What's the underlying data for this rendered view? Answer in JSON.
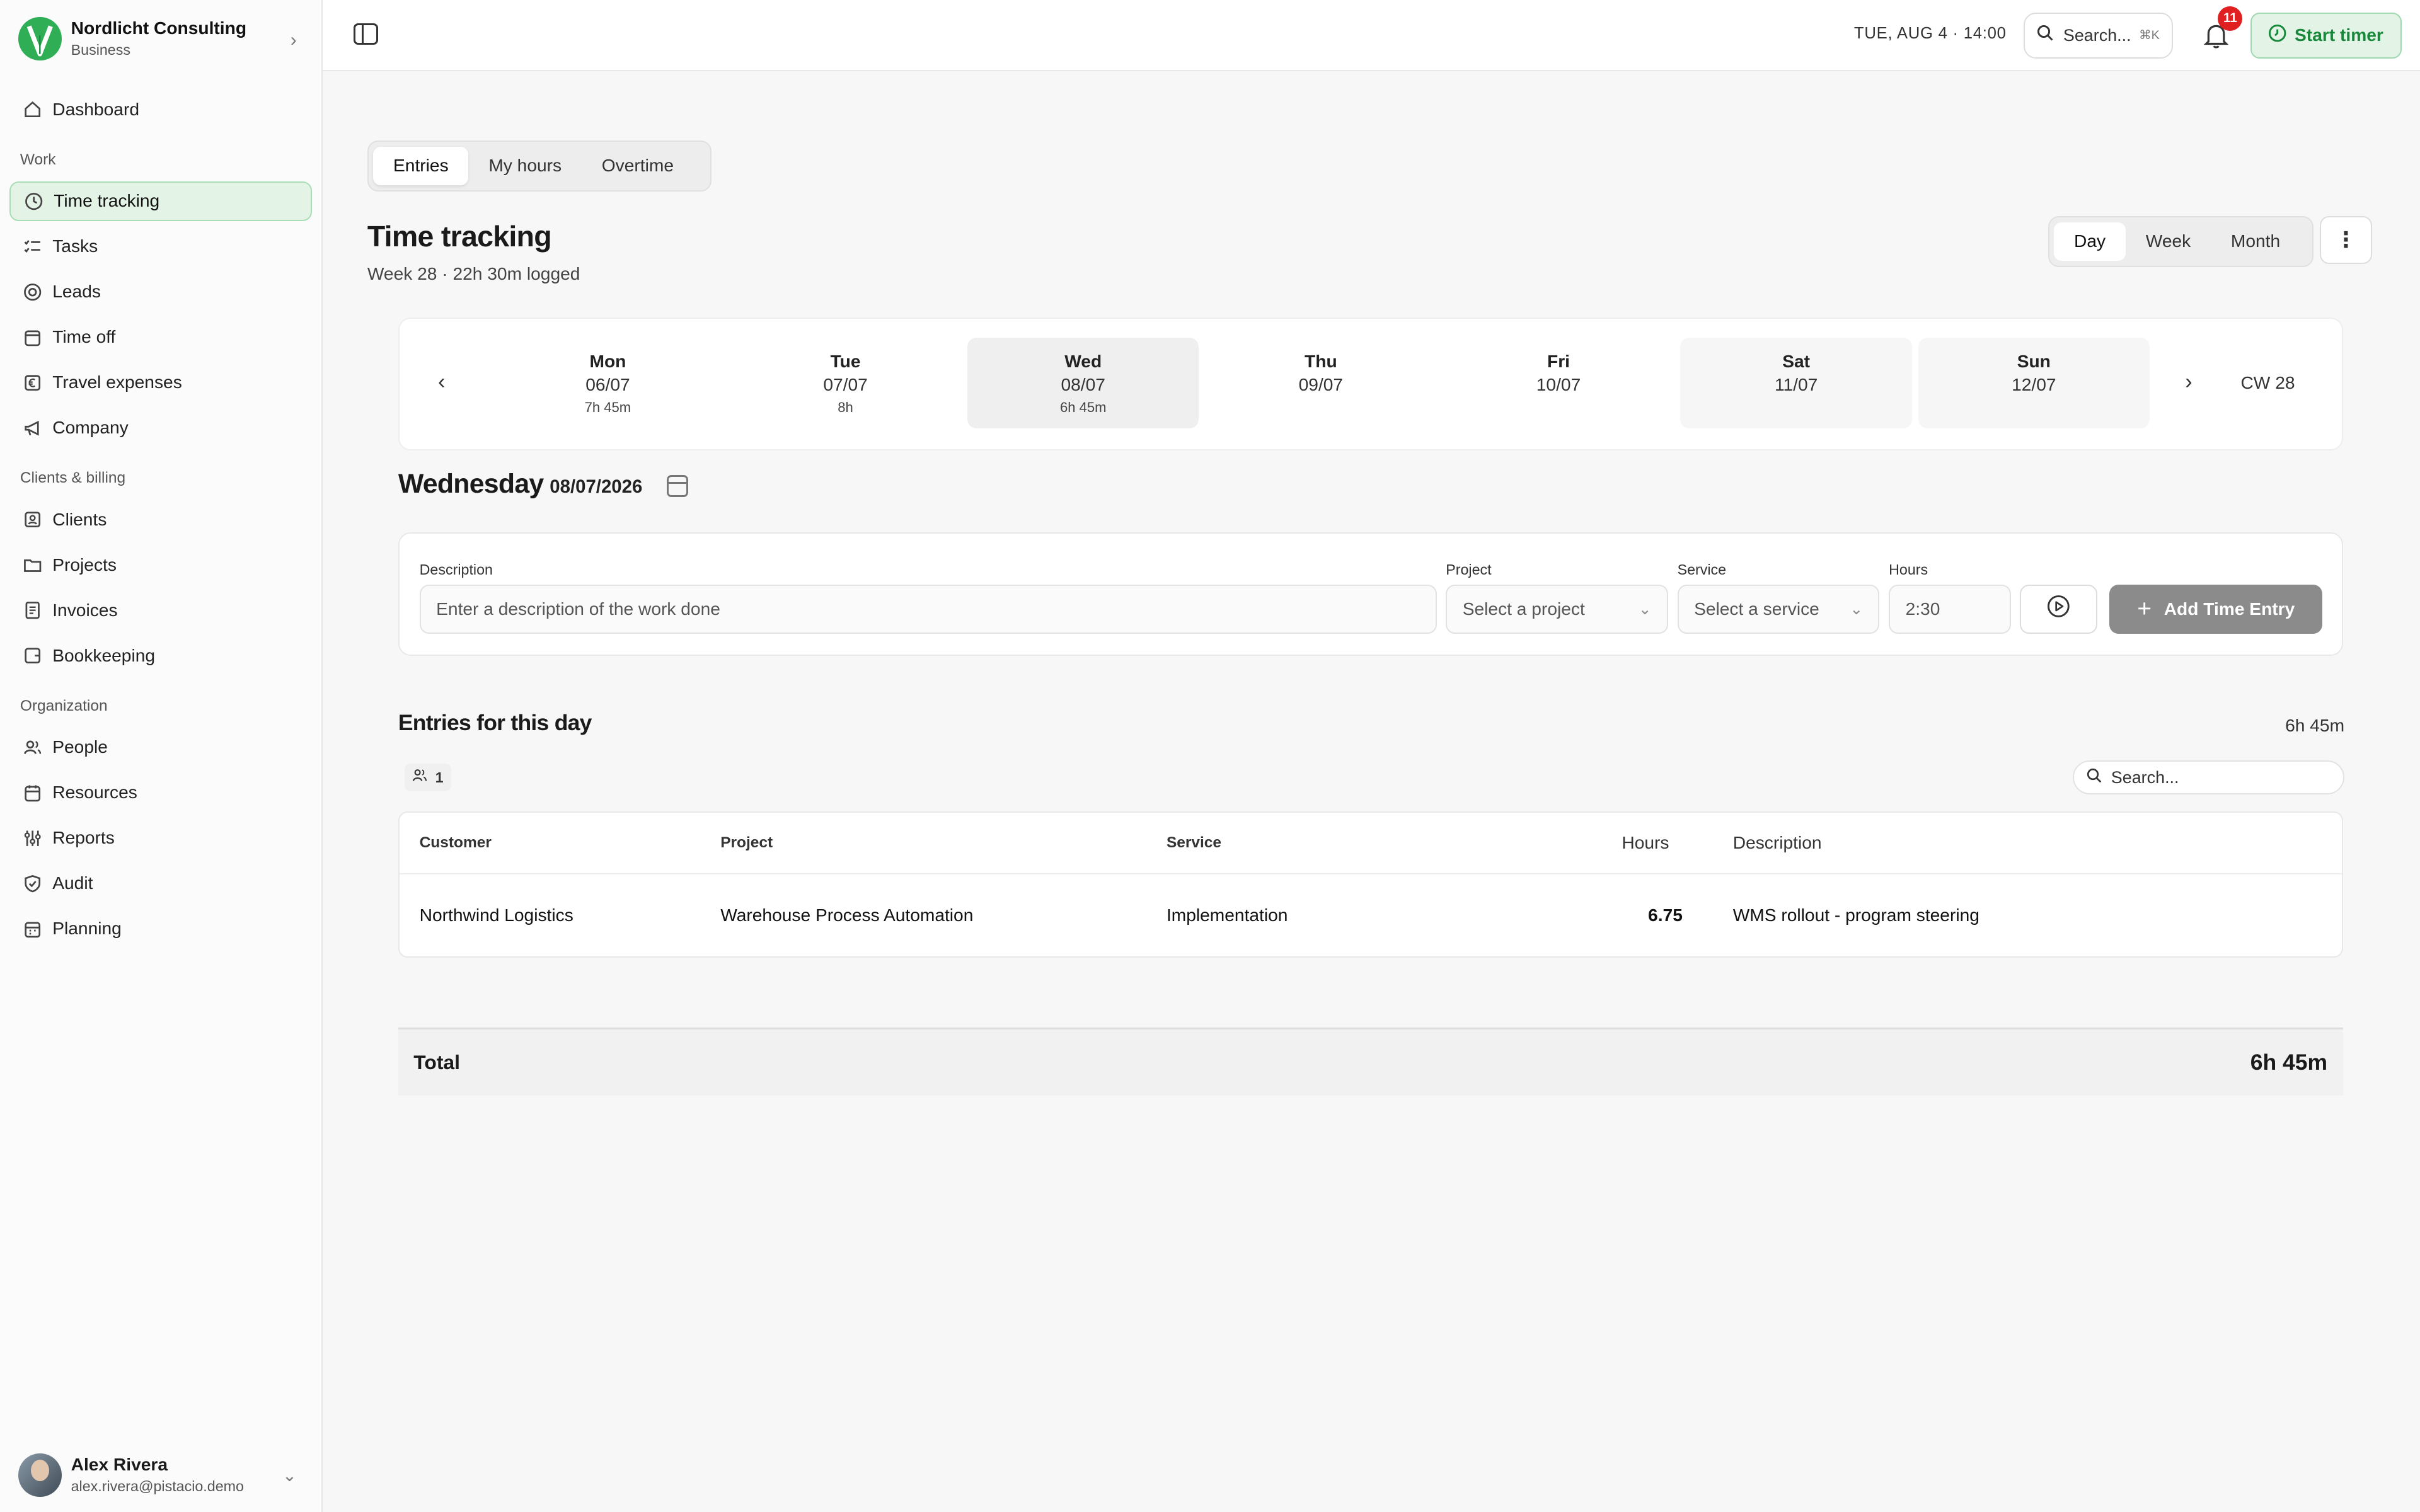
{
  "brand": {
    "name": "Nordlicht Consulting",
    "plan": "Business"
  },
  "nav": {
    "dashboard": "Dashboard",
    "sections": [
      {
        "title": "Work",
        "items": [
          "Time tracking",
          "Tasks",
          "Leads",
          "Time off",
          "Travel expenses",
          "Company"
        ]
      },
      {
        "title": "Clients & billing",
        "items": [
          "Clients",
          "Projects",
          "Invoices",
          "Bookkeeping"
        ]
      },
      {
        "title": "Organization",
        "items": [
          "People",
          "Resources",
          "Reports",
          "Audit",
          "Planning"
        ]
      }
    ],
    "active": "Time tracking"
  },
  "user": {
    "name": "Alex Rivera",
    "email": "alex.rivera@pistacio.demo"
  },
  "topbar": {
    "datetime": "TUE, AUG 4 · 14:00",
    "search_label": "Search...",
    "search_shortcut": "⌘K",
    "notification_count": "11",
    "start_timer": "Start timer"
  },
  "subtabs": [
    "Entries",
    "My hours",
    "Overtime"
  ],
  "page": {
    "title": "Time tracking",
    "subtitle": "Week 28 · 22h 30m logged"
  },
  "range": [
    "Day",
    "Week",
    "Month"
  ],
  "week": {
    "cw": "CW 28",
    "days": [
      {
        "name": "Mon",
        "date": "06/07",
        "hours": "7h 45m"
      },
      {
        "name": "Tue",
        "date": "07/07",
        "hours": "8h"
      },
      {
        "name": "Wed",
        "date": "08/07",
        "hours": "6h 45m"
      },
      {
        "name": "Thu",
        "date": "09/07",
        "hours": ""
      },
      {
        "name": "Fri",
        "date": "10/07",
        "hours": ""
      },
      {
        "name": "Sat",
        "date": "11/07",
        "hours": ""
      },
      {
        "name": "Sun",
        "date": "12/07",
        "hours": ""
      }
    ]
  },
  "day_heading": {
    "name": "Wednesday",
    "date": "08/07/2026"
  },
  "form": {
    "description_label": "Description",
    "description_placeholder": "Enter a description of the work done",
    "project_label": "Project",
    "project_placeholder": "Select a project",
    "service_label": "Service",
    "service_placeholder": "Select a service",
    "hours_label": "Hours",
    "hours_value": "2:30",
    "add_button": "Add Time Entry"
  },
  "entries": {
    "title": "Entries for this day",
    "total": "6h 45m",
    "people_count": "1",
    "search_placeholder": "Search...",
    "columns": [
      "Customer",
      "Project",
      "Service",
      "Hours",
      "Description"
    ],
    "rows": [
      {
        "customer": "Northwind Logistics",
        "project": "Warehouse Process Automation",
        "service": "Implementation",
        "hours": "6.75",
        "description": "WMS rollout - program steering"
      }
    ],
    "footer_label": "Total",
    "footer_value": "6h 45m"
  },
  "colors": {
    "accent": "#2fae56",
    "accent_bg": "#e3f4e7",
    "badge": "#e02020",
    "button_disabled": "#8b8b8b"
  }
}
